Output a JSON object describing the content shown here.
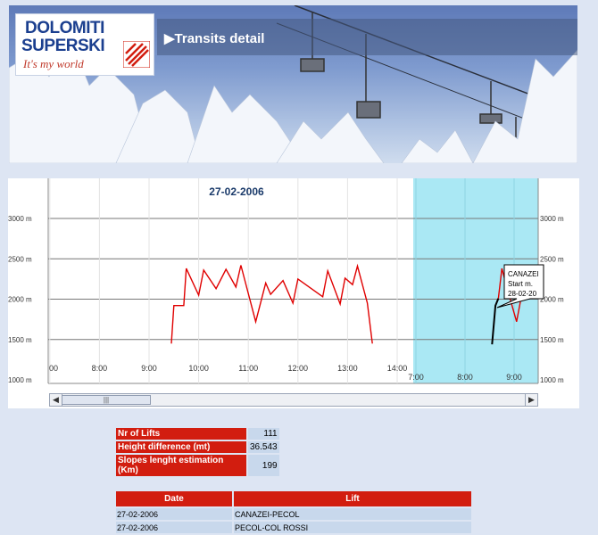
{
  "header": {
    "logo_line1": "DOLOMITI",
    "logo_line2": "SUPERSKI",
    "logo_tagline": "It's my world",
    "title": "Transits detail"
  },
  "chart_data": {
    "type": "line",
    "title": "27-02-2006",
    "y_ticks": [
      "1000 m",
      "1500 m",
      "2000 m",
      "2500 m",
      "3000 m"
    ],
    "ylim": [
      1000,
      3200
    ],
    "x_ticks_day1": [
      "00",
      "8:00",
      "9:00",
      "10:00",
      "11:00",
      "12:00",
      "13:00",
      "14:00"
    ],
    "x_ticks_day2": [
      "7:00",
      "8:00",
      "9:00"
    ],
    "series": [
      {
        "color": "#e00000",
        "x": [
          9.45,
          9.5,
          9.7,
          9.75,
          10.0,
          10.1,
          10.35,
          10.55,
          10.75,
          10.85,
          11.15,
          11.35,
          11.45,
          11.7,
          11.9,
          12.0,
          12.5,
          12.6,
          12.85,
          12.95,
          13.1,
          13.2,
          13.4,
          13.5
        ],
        "y": [
          1450,
          1920,
          1920,
          2380,
          2050,
          2360,
          2130,
          2370,
          2150,
          2420,
          1720,
          2200,
          2060,
          2230,
          1950,
          2250,
          2030,
          2350,
          1940,
          2260,
          2180,
          2410,
          1950,
          1450
        ]
      },
      {
        "color": "#000000",
        "day": 2,
        "x": [
          8.55,
          8.62,
          8.68
        ],
        "y": [
          1440,
          1920,
          2010
        ]
      },
      {
        "color": "#e00000",
        "day": 2,
        "x": [
          8.68,
          8.75,
          8.85,
          9.05,
          9.2
        ],
        "y": [
          2010,
          2380,
          2150,
          1720,
          2200
        ]
      }
    ],
    "tooltip": {
      "line1": "CANAZEI",
      "line2": "Start m.",
      "line3": "28-02-20"
    }
  },
  "summary": {
    "rows": [
      {
        "label": "Nr of Lifts",
        "value": "111"
      },
      {
        "label": "Height difference (mt)",
        "value": "36.543"
      },
      {
        "label": "Slopes lenght estimation (Km)",
        "value": "199"
      }
    ]
  },
  "transits": {
    "headers": [
      "Date",
      "Lift"
    ],
    "rows": [
      {
        "date": "27-02-2006",
        "lift": "CANAZEI-PECOL"
      },
      {
        "date": "27-02-2006",
        "lift": "PECOL-COL ROSSI"
      }
    ]
  },
  "colors": {
    "accent_red": "#d21d0f",
    "next_day_bg": "#aae8f4",
    "page_bg": "#dde5f3"
  }
}
